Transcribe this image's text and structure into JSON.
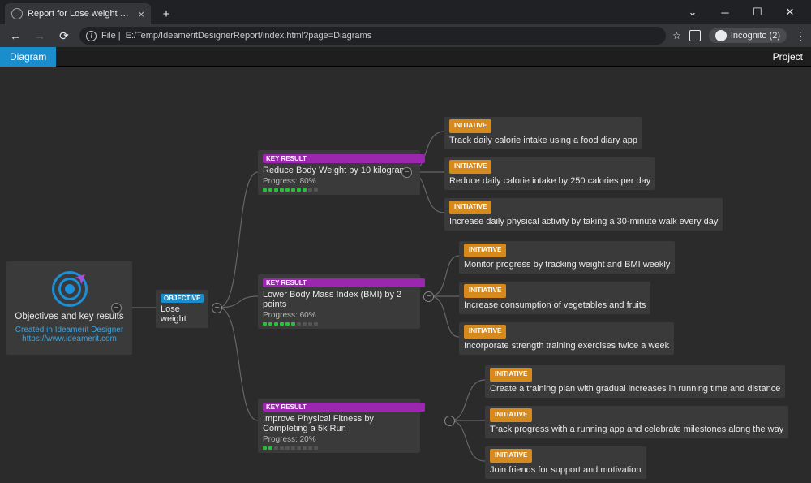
{
  "browser": {
    "tab_title": "Report for Lose weight made in",
    "url_prefix": "File |",
    "url": "E:/Temp/IdeameritDesignerReport/index.html?page=Diagrams",
    "incognito_label": "Incognito (2)"
  },
  "app": {
    "active_tab": "Diagram",
    "right_tab": "Project"
  },
  "root": {
    "title": "Objectives and key results",
    "subtitle": "Created in Ideamerit Designer",
    "link": "https://www.ideamerit.com"
  },
  "badges": {
    "objective": "OBJECTIVE",
    "key_result": "KEY RESULT",
    "initiative": "INITIATIVE"
  },
  "objective": {
    "title": "Lose weight"
  },
  "key_results": [
    {
      "title": "Reduce Body Weight by 10 kilograms",
      "progress_label": "Progress: 80%",
      "progress": 8
    },
    {
      "title": "Lower Body Mass Index (BMI) by 2 points",
      "progress_label": "Progress: 60%",
      "progress": 6
    },
    {
      "title": "Improve Physical Fitness by Completing a 5k Run",
      "progress_label": "Progress: 20%",
      "progress": 2
    }
  ],
  "initiatives": {
    "kr0": [
      "Track daily calorie intake using a food diary app",
      "Reduce daily calorie intake by 250 calories per day",
      "Increase daily physical activity by taking a 30-minute walk every day"
    ],
    "kr1": [
      "Monitor progress by tracking weight and BMI weekly",
      "Increase consumption of vegetables and fruits",
      "Incorporate strength training exercises twice a week"
    ],
    "kr2": [
      "Create a training plan with gradual increases in running time and distance",
      "Track progress with a running app and celebrate milestones along the way",
      "Join friends for support and motivation"
    ]
  }
}
